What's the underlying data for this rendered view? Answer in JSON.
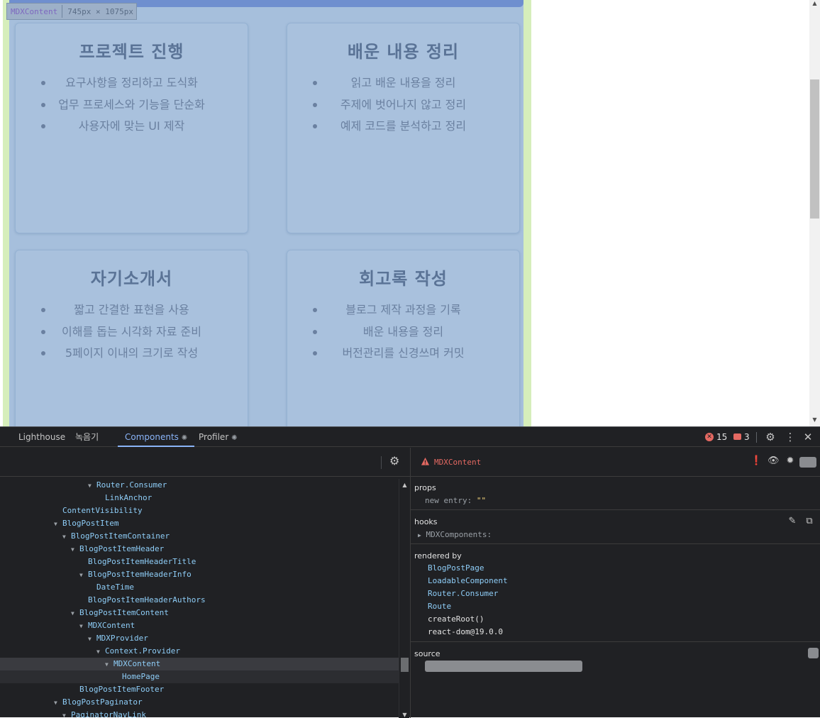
{
  "inspect_tooltip": {
    "component": "MDXContent",
    "dimensions": "745px × 1075px"
  },
  "cards": [
    {
      "title": "프로젝트 진행",
      "items": [
        "요구사항을 정리하고 도식화",
        "업무 프로세스와 기능을 단순화",
        "사용자에 맞는 UI 제작"
      ]
    },
    {
      "title": "배운 내용 정리",
      "items": [
        "읽고 배운 내용을 정리",
        "주제에 벗어나지 않고 정리",
        "예제 코드를 분석하고 정리"
      ]
    },
    {
      "title": "자기소개서",
      "items": [
        "짧고 간결한 표현을 사용",
        "이해를 돕는 시각화 자료 준비",
        "5페이지 이내의 크기로 작성"
      ]
    },
    {
      "title": "회고록 작성",
      "items": [
        "블로그 제작 과정을 기록",
        "배운 내용을 정리",
        "버전관리를 신경쓰며 커밋"
      ]
    }
  ],
  "devtools": {
    "tabs": [
      "Lighthouse",
      "녹음기",
      "Components",
      "Profiler"
    ],
    "active_tab": "Components",
    "error_count": "15",
    "warning_count": "3",
    "tree": [
      {
        "label": "Router.Consumer",
        "depth": 10,
        "expanded": true
      },
      {
        "label": "LinkAnchor",
        "depth": 11,
        "expanded": false
      },
      {
        "label": "ContentVisibility",
        "depth": 6,
        "expanded": false
      },
      {
        "label": "BlogPostItem",
        "depth": 6,
        "expanded": true
      },
      {
        "label": "BlogPostItemContainer",
        "depth": 7,
        "expanded": true
      },
      {
        "label": "BlogPostItemHeader",
        "depth": 8,
        "expanded": true
      },
      {
        "label": "BlogPostItemHeaderTitle",
        "depth": 9,
        "expanded": false
      },
      {
        "label": "BlogPostItemHeaderInfo",
        "depth": 9,
        "expanded": true
      },
      {
        "label": "DateTime",
        "depth": 10,
        "expanded": false
      },
      {
        "label": "BlogPostItemHeaderAuthors",
        "depth": 9,
        "expanded": false
      },
      {
        "label": "BlogPostItemContent",
        "depth": 8,
        "expanded": true
      },
      {
        "label": "MDXContent",
        "depth": 9,
        "expanded": true
      },
      {
        "label": "MDXProvider",
        "depth": 10,
        "expanded": true
      },
      {
        "label": "Context.Provider",
        "depth": 11,
        "expanded": true
      },
      {
        "label": "MDXContent",
        "depth": 12,
        "expanded": true,
        "selected": true
      },
      {
        "label": "HomePage",
        "depth": 13,
        "expanded": false,
        "hover": true
      },
      {
        "label": "BlogPostItemFooter",
        "depth": 8,
        "expanded": false
      },
      {
        "label": "BlogPostPaginator",
        "depth": 6,
        "expanded": true
      },
      {
        "label": "PaginatorNavLink",
        "depth": 7,
        "expanded": true
      }
    ],
    "selected_component": "MDXContent",
    "props": {
      "title": "props",
      "key": "new entry",
      "value": "\"\""
    },
    "hooks": {
      "title": "hooks",
      "item": "MDXComponents:"
    },
    "rendered_by": {
      "title": "rendered by",
      "components": [
        "BlogPostPage",
        "LoadableComponent",
        "Router.Consumer",
        "Route"
      ],
      "plain": [
        "createRoot()",
        "react-dom@19.0.0"
      ]
    },
    "source": {
      "title": "source"
    }
  }
}
